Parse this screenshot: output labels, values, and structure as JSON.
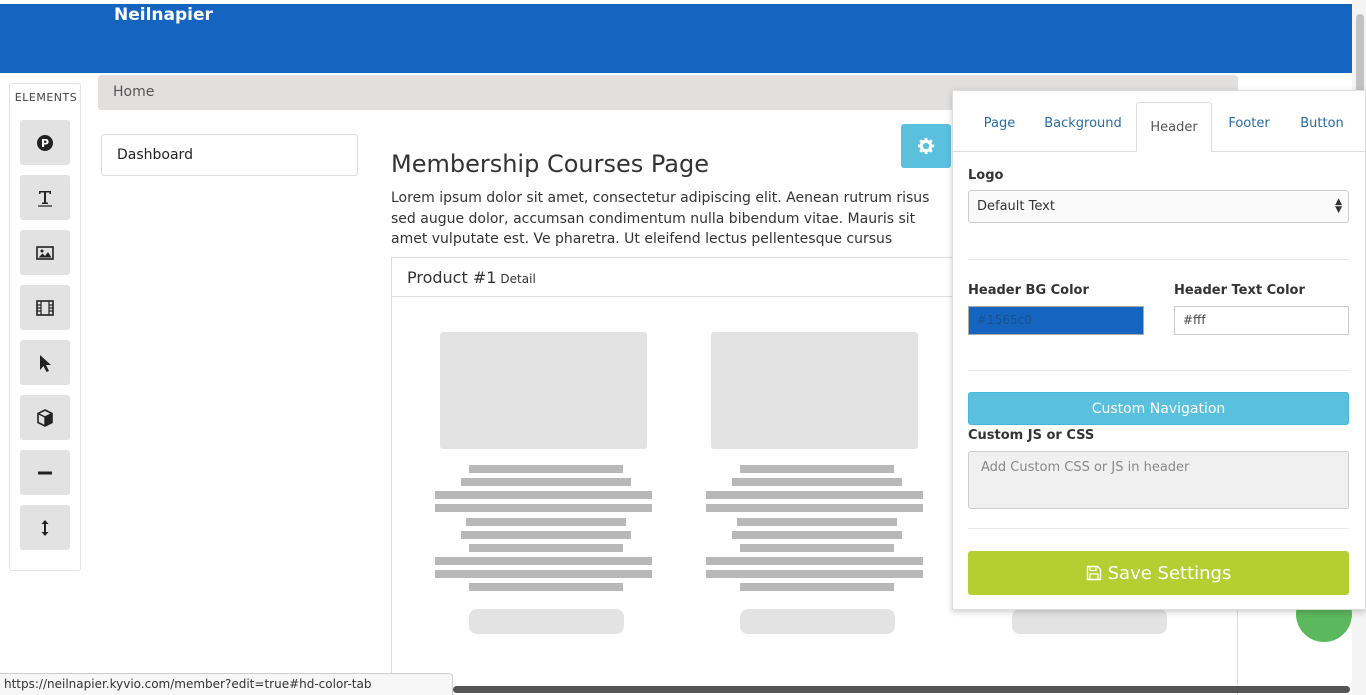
{
  "header": {
    "brand": "Neilnapier",
    "bg_color": "#1565c0"
  },
  "elements_sidebar": {
    "title": "ELEMENTS",
    "items": [
      {
        "icon": "p-badge-icon"
      },
      {
        "icon": "text-icon"
      },
      {
        "icon": "image-icon"
      },
      {
        "icon": "video-icon"
      },
      {
        "icon": "cursor-icon"
      },
      {
        "icon": "cube-icon"
      },
      {
        "icon": "divider-icon"
      },
      {
        "icon": "spacer-icon"
      }
    ]
  },
  "breadcrumb": {
    "home": "Home"
  },
  "menu": {
    "dashboard": "Dashboard"
  },
  "content": {
    "title": "Membership Courses Page",
    "description": "Lorem ipsum dolor sit amet, consectetur adipiscing elit. Aenean rutrum risus sed augue dolor, accumsan condimentum nulla bibendum vitae. Mauris sit amet vulputate est. Ve pharetra. Ut eleifend lectus pellentesque cursus semper.",
    "product": {
      "name": "Product #1",
      "detail": "Detail"
    }
  },
  "settings_panel": {
    "tabs": [
      {
        "label": "Page",
        "active": false
      },
      {
        "label": "Background",
        "active": false
      },
      {
        "label": "Header",
        "active": true
      },
      {
        "label": "Footer",
        "active": false
      },
      {
        "label": "Button",
        "active": false
      }
    ],
    "logo_label": "Logo",
    "logo_value": "Default Text",
    "header_bg_label": "Header BG Color",
    "header_bg_value": "#1565c0",
    "header_text_label": "Header Text Color",
    "header_text_value": "#fff",
    "custom_nav_label": "Custom Navigation",
    "custom_js_label": "Custom JS or CSS",
    "custom_js_placeholder": "Add Custom CSS or JS in header",
    "save_label": "Save Settings",
    "accent_color": "#b5cf33",
    "info_color": "#5bc0de"
  },
  "status_bar": {
    "url": "https://neilnapier.kyvio.com/member?edit=true#hd-color-tab"
  }
}
